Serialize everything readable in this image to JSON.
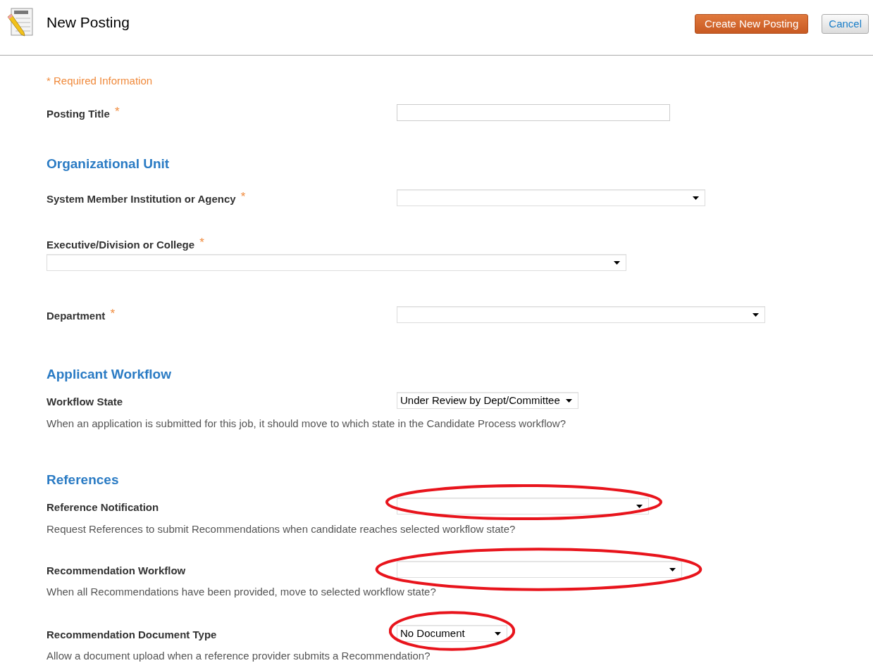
{
  "header": {
    "title": "New Posting",
    "buttons": [
      {
        "label": "Create New Posting",
        "kind": "primary"
      },
      {
        "label": "Cancel",
        "kind": "secondary"
      }
    ]
  },
  "required_note": "* Required Information",
  "sections": [
    {
      "fields": [
        {
          "label": "Posting Title",
          "required_mark": "*",
          "kind": "text",
          "annotated": false
        }
      ]
    },
    {
      "heading": "Organizational Unit",
      "fields": [
        {
          "label": "System Member Institution or Agency",
          "required_mark": "*",
          "kind": "select",
          "annotated": false
        },
        {
          "label": "Executive/Division or College",
          "required_mark": "*",
          "kind": "select",
          "annotated": false
        },
        {
          "label": "Department",
          "required_mark": "*",
          "kind": "select",
          "annotated": false
        }
      ]
    },
    {
      "heading": "Applicant Workflow",
      "fields": [
        {
          "label": "Workflow State",
          "kind": "select",
          "value": "Under Review by Dept/Committee",
          "annotated": false,
          "help": "When an application is submitted for this job, it should move to which state in the Candidate Process workflow?"
        }
      ]
    },
    {
      "heading": "References",
      "fields": [
        {
          "label": "Reference Notification",
          "kind": "select",
          "annotated": true,
          "help": "Request References to submit Recommendations when candidate reaches selected workflow state?"
        },
        {
          "label": "Recommendation Workflow",
          "kind": "select",
          "annotated": true,
          "help": "When all Recommendations have been provided, move to selected workflow state?"
        },
        {
          "label": "Recommendation Document Type",
          "kind": "select",
          "value": "No Document",
          "annotated": true,
          "help": "Allow a document upload when a reference provider submits a Recommendation?"
        }
      ]
    }
  ]
}
